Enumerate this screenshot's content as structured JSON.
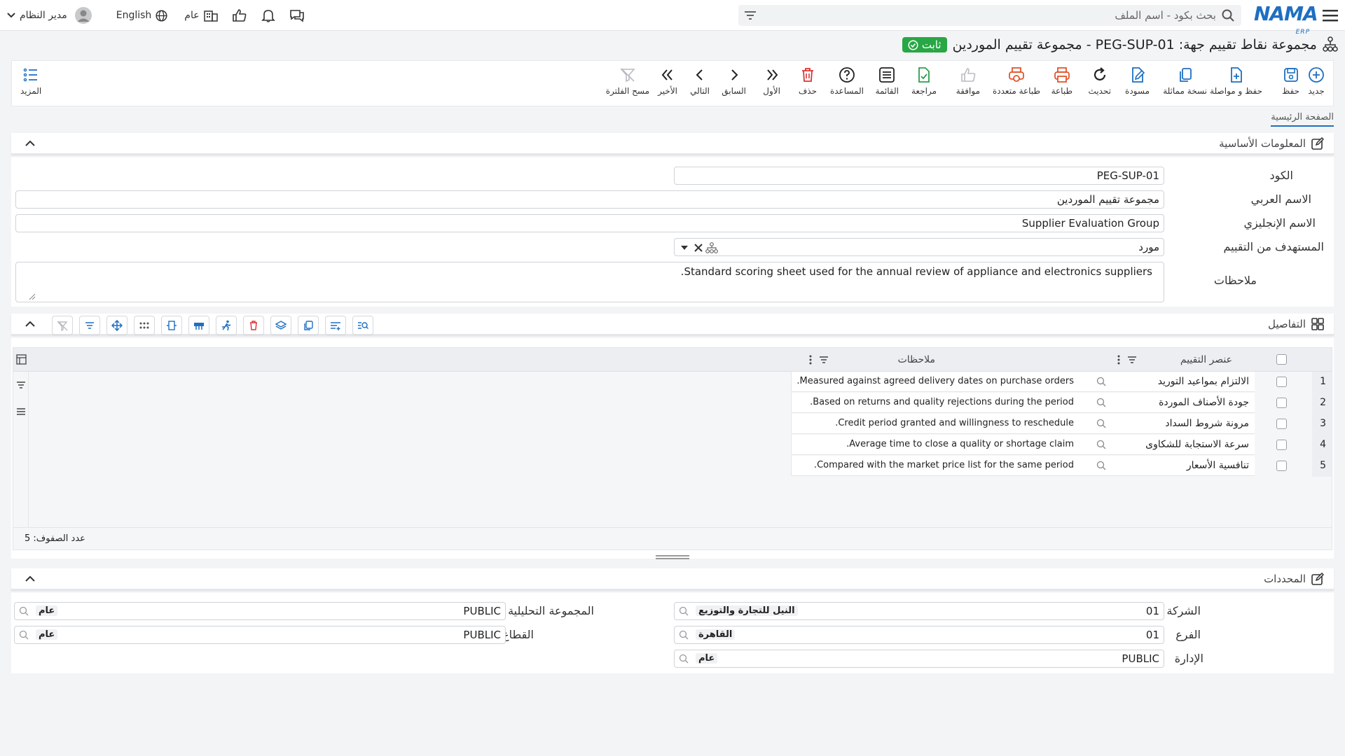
{
  "topbar": {
    "search_placeholder": "بحث بكود - اسم الملف",
    "logo": "NAMA",
    "logo_sub": "ERP",
    "user": "مدير النظام",
    "language": "English",
    "general": "عام"
  },
  "page": {
    "title": "مجموعة نقاط تقييم جهة: PEG-SUP-01 - مجموعة تقييم الموردين",
    "status": "ثابت"
  },
  "toolbar": {
    "new": "جديد",
    "save": "حفظ",
    "save_continue": "حفظ و مواصلة",
    "copy": "نسخة مماثلة",
    "draft": "مسودة",
    "refresh": "تحديث",
    "print": "طباعة",
    "multi_print": "طباعة متعددة",
    "approve": "موافقة",
    "review": "مراجعة",
    "list": "القائمة",
    "help": "المساعدة",
    "delete": "حذف",
    "first": "الأول",
    "prev": "السابق",
    "next": "التالي",
    "last": "الأخير",
    "clear_filter": "مسح الفلترة",
    "more": "المزيد"
  },
  "tabs": {
    "main": "الصفحة الرئيسية"
  },
  "basic": {
    "heading": "المعلومات الأساسية",
    "code_label": "الكود",
    "code": "PEG-SUP-01",
    "ar_label": "الاسم العربي",
    "ar_name": "مجموعة تقييم الموردين",
    "en_label": "الاسم الإنجليزي",
    "en_name": "Supplier Evaluation Group",
    "target_label": "المستهدف من التقييم",
    "target": "مورد",
    "notes_label": "ملاحظات",
    "notes": "Standard scoring sheet used for the annual review of appliance and electronics suppliers."
  },
  "details": {
    "heading": "التفاصيل",
    "col_item": "عنصر التقييم",
    "col_notes": "ملاحظات",
    "row_count": "عدد الصفوف: 5",
    "rows": [
      {
        "n": "1",
        "item": "الالتزام بمواعيد التوريد",
        "note": "Measured against agreed delivery dates on purchase orders."
      },
      {
        "n": "2",
        "item": "جودة الأصناف الموردة",
        "note": "Based on returns and quality rejections during the period."
      },
      {
        "n": "3",
        "item": "مرونة شروط السداد",
        "note": "Credit period granted and willingness to reschedule."
      },
      {
        "n": "4",
        "item": "سرعة الاستجابة للشكاوى",
        "note": "Average time to close a quality or shortage claim."
      },
      {
        "n": "5",
        "item": "تنافسية الأسعار",
        "note": "Compared with the market price list for the same period."
      }
    ]
  },
  "determinants": {
    "heading": "المحددات",
    "company_label": "الشركة",
    "company_code": "01",
    "company_name": "النيل للتجارة والتوزيع",
    "branch_label": "الفرع",
    "branch_code": "01",
    "branch_name": "القاهرة",
    "dept_label": "الإدارة",
    "dept_code": "PUBLIC",
    "dept_name": "عام",
    "analytic_label": "المجموعة التحليلية",
    "analytic_code": "PUBLIC",
    "analytic_name": "عام",
    "sector_label": "القطاع",
    "sector_code": "PUBLIC",
    "sector_name": "عام"
  }
}
